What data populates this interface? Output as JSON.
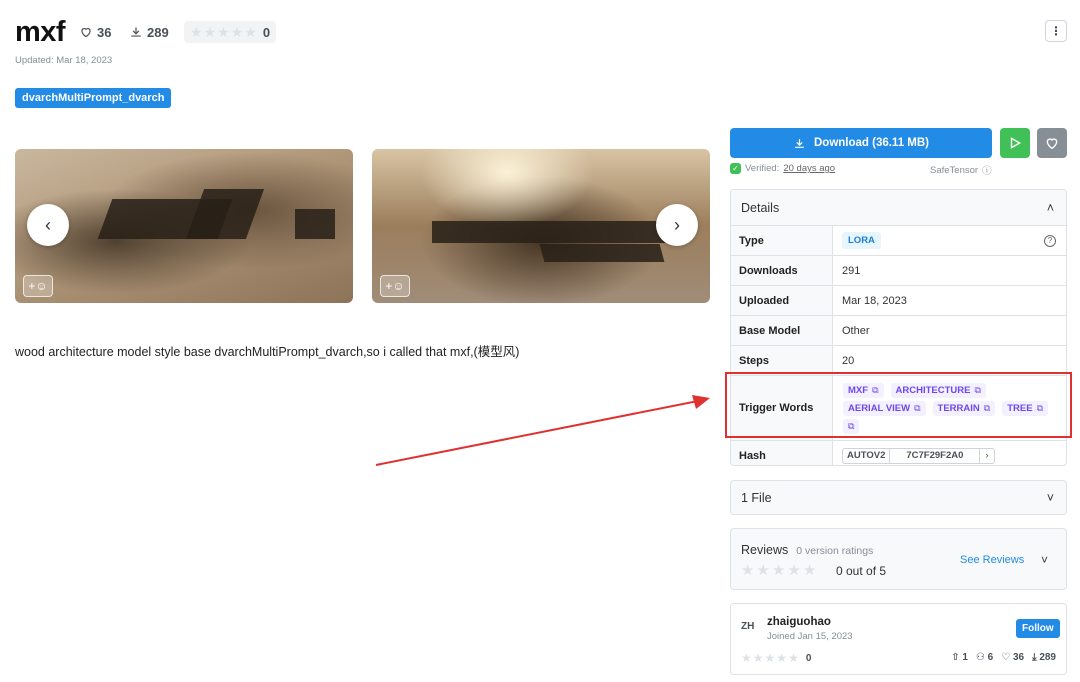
{
  "model": {
    "title": "mxf",
    "likes": "36",
    "downloads": "289",
    "rating_count": "0",
    "updated": "Updated: Mar 18, 2023",
    "tag": "dvarchMultiPrompt_dvarch"
  },
  "description": "wood architecture model style base dvarchMultiPrompt_dvarch,so i called that mxf,(模型风)",
  "actions": {
    "download_label": "Download (36.11 MB)",
    "verified_prefix": "Verified:",
    "verified_when": "20 days ago",
    "safetensor": "SafeTensor"
  },
  "details": {
    "header": "Details",
    "rows": [
      {
        "label": "Type",
        "value": "LORA"
      },
      {
        "label": "Downloads",
        "value": "291"
      },
      {
        "label": "Uploaded",
        "value": "Mar 18, 2023"
      },
      {
        "label": "Base Model",
        "value": "Other"
      },
      {
        "label": "Steps",
        "value": "20"
      },
      {
        "label": "Trigger Words",
        "value": ""
      },
      {
        "label": "Hash",
        "value": ""
      }
    ],
    "trigger_words": [
      "MXF",
      "ARCHITECTURE",
      "AERIAL VIEW",
      "TERRAIN",
      "TREE",
      ""
    ],
    "hash_type": "AUTOV2",
    "hash_value": "7C7F29F2A0"
  },
  "files": {
    "label": "1 File"
  },
  "reviews": {
    "title": "Reviews",
    "sub": "0 version ratings",
    "out_of": "0 out of 5",
    "see_link": "See Reviews"
  },
  "user": {
    "avatar": "ZH",
    "name": "zhaiguohao",
    "joined": "Joined Jan 15, 2023",
    "follow": "Follow",
    "rating": "0",
    "uploads": "1",
    "followers": "6",
    "favorites": "36",
    "downloads": "289"
  },
  "colors": {
    "primary": "#228be6",
    "success": "#40c057",
    "highlight": "#e03131",
    "trigger_text": "#7048e8"
  }
}
